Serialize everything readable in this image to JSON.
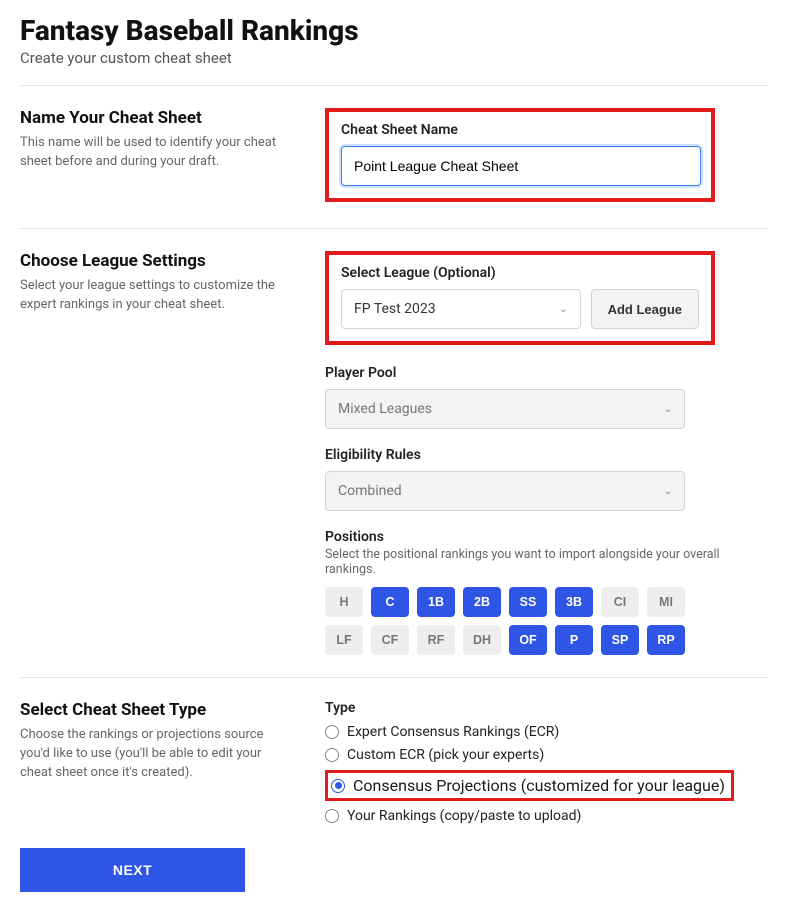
{
  "header": {
    "title": "Fantasy Baseball Rankings",
    "subtitle": "Create your custom cheat sheet"
  },
  "section1": {
    "heading": "Name Your Cheat Sheet",
    "desc": "This name will be used to identify your cheat sheet before and during your draft.",
    "field_label": "Cheat Sheet Name",
    "value": "Point League Cheat Sheet"
  },
  "section2": {
    "heading": "Choose League Settings",
    "desc": "Select your league settings to customize the expert rankings in your cheat sheet.",
    "league_label": "Select League (Optional)",
    "league_value": "FP Test 2023",
    "add_league_label": "Add League",
    "pool_label": "Player Pool",
    "pool_value": "Mixed Leagues",
    "elig_label": "Eligibility Rules",
    "elig_value": "Combined",
    "positions_label": "Positions",
    "positions_sub": "Select the positional rankings you want to import alongside your overall rankings.",
    "positions": [
      {
        "label": "H",
        "selected": false
      },
      {
        "label": "C",
        "selected": true
      },
      {
        "label": "1B",
        "selected": true
      },
      {
        "label": "2B",
        "selected": true
      },
      {
        "label": "SS",
        "selected": true
      },
      {
        "label": "3B",
        "selected": true
      },
      {
        "label": "CI",
        "selected": false
      },
      {
        "label": "MI",
        "selected": false
      },
      {
        "label": "LF",
        "selected": false
      },
      {
        "label": "CF",
        "selected": false
      },
      {
        "label": "RF",
        "selected": false
      },
      {
        "label": "DH",
        "selected": false
      },
      {
        "label": "OF",
        "selected": true
      },
      {
        "label": "P",
        "selected": true
      },
      {
        "label": "SP",
        "selected": true
      },
      {
        "label": "RP",
        "selected": true
      }
    ]
  },
  "section3": {
    "heading": "Select Cheat Sheet Type",
    "desc": "Choose the rankings or projections source you'd like to use (you'll be able to edit your cheat sheet once it's created).",
    "type_label": "Type",
    "options": [
      {
        "label": "Expert Consensus Rankings (ECR)",
        "selected": false,
        "highlight": false
      },
      {
        "label": "Custom ECR (pick your experts)",
        "selected": false,
        "highlight": false
      },
      {
        "label": "Consensus Projections (customized for your league)",
        "selected": true,
        "highlight": true
      },
      {
        "label": "Your Rankings (copy/paste to upload)",
        "selected": false,
        "highlight": false
      }
    ]
  },
  "footer": {
    "next_label": "NEXT"
  }
}
